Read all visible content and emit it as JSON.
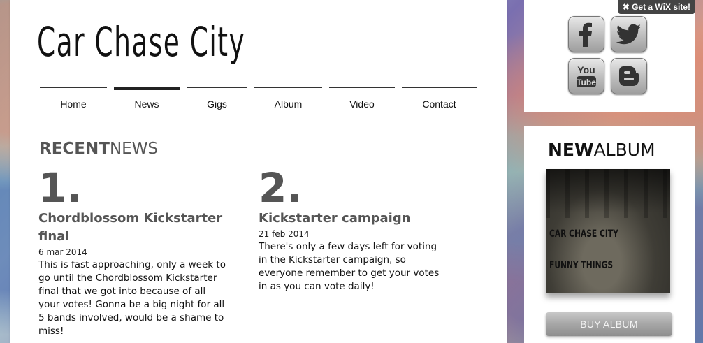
{
  "site": {
    "title": "Car Chase City"
  },
  "nav": {
    "items": [
      {
        "label": "Home",
        "active": false
      },
      {
        "label": "News",
        "active": true
      },
      {
        "label": "Gigs",
        "active": false
      },
      {
        "label": "Album",
        "active": false
      },
      {
        "label": "Video",
        "active": false
      },
      {
        "label": "Contact",
        "active": false
      }
    ]
  },
  "news": {
    "title_bold": "RECENT",
    "title_light": "NEWS",
    "posts": [
      {
        "number": "1.",
        "headline": "Chordblossom Kickstarter final",
        "date": "6 mar 2014",
        "body": "This is fast approaching, only a week to go until the Chordblossom Kickstarter final that we got into because of all your votes! Gonna be a big night for all 5 bands involved, would be a shame to miss!"
      },
      {
        "number": "2.",
        "headline": "Kickstarter campaign",
        "date": "21 feb 2014",
        "body": "There's only a few days left for voting in the Kickstarter campaign, so everyone remember to get your votes in as you can vote daily!"
      }
    ]
  },
  "social": {
    "icons": [
      "facebook-icon",
      "twitter-icon",
      "youtube-icon",
      "blogger-icon"
    ],
    "wix_badge": "Get a WiX site!"
  },
  "album": {
    "title_bold": "NEW",
    "title_light": "ALBUM",
    "cover_line1": "CAR CHASE CITY",
    "cover_line2": "FUNNY THINGS",
    "buy_label": "BUY ALBUM"
  }
}
